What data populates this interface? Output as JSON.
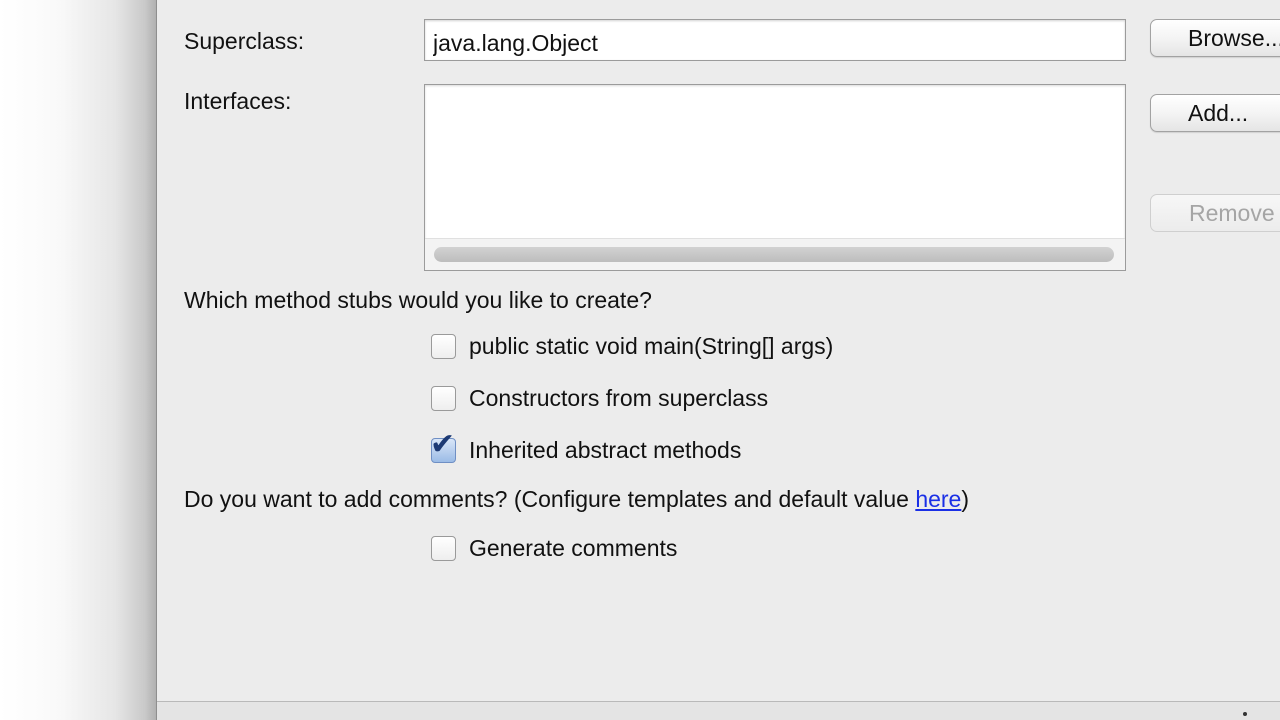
{
  "superclass": {
    "label": "Superclass:",
    "value": "java.lang.Object",
    "browse_label": "Browse..."
  },
  "interfaces": {
    "label": "Interfaces:",
    "add_label": "Add...",
    "remove_label": "Remove"
  },
  "method_stubs": {
    "question": "Which method stubs would you like to create?",
    "options": [
      {
        "label": "public static void main(String[] args)",
        "checked": false
      },
      {
        "label": "Constructors from superclass",
        "checked": false
      },
      {
        "label": "Inherited abstract methods",
        "checked": true
      }
    ]
  },
  "comments": {
    "question_prefix": "Do you want to add comments? (Configure templates and default value ",
    "link_text": "here",
    "question_suffix": ")",
    "option_label": "Generate comments",
    "option_checked": false
  },
  "icons": {
    "checkmark": "checkmark-icon"
  },
  "colors": {
    "dialog_bg": "#ececec",
    "link": "#1a2fe6",
    "checked_fill": "#9bbbe6"
  }
}
